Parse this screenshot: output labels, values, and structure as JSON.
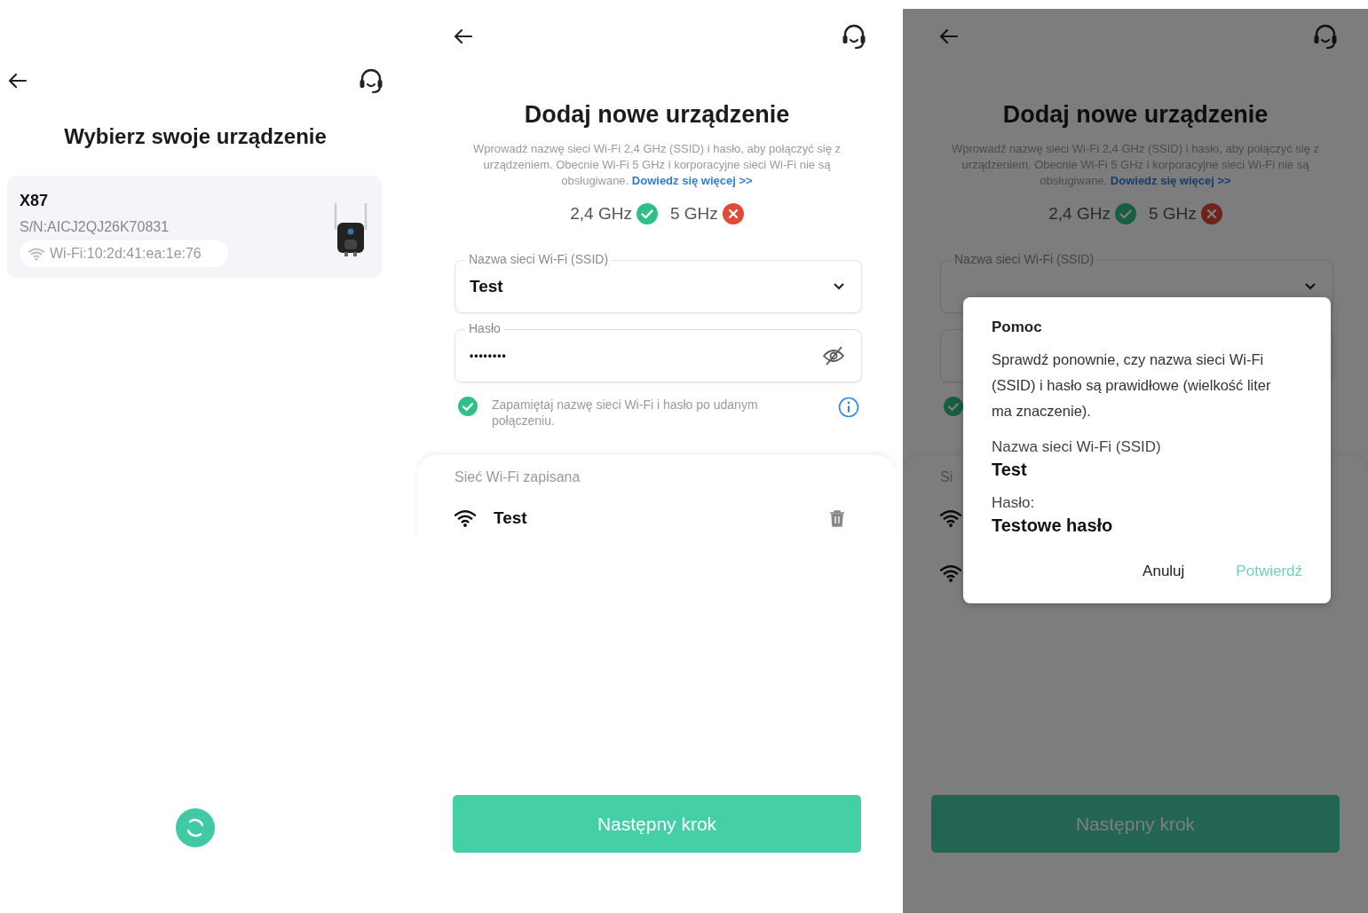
{
  "screens": [
    {
      "kind": "device_select",
      "title": "Wybierz swoje urządzenie",
      "devices": [
        {
          "name": "X87",
          "serial": "S/N:AICJ2QJ26K70831",
          "wifi": "Wi-Fi:10:2d:41:ea:1e:76"
        }
      ]
    },
    {
      "kind": "add_device",
      "dimmed": false,
      "title": "Dodaj nowe urządzenie",
      "description": "Wprowadź nazwę sieci Wi-Fi 2,4 GHz (SSID) i hasło, aby połączyć się z urządzeniem. Obecnie Wi-Fi 5 GHz i korporacyjne sieci Wi-Fi nie są obsługiwane.",
      "link": "Dowiedz się więcej >>",
      "bands": [
        {
          "label": "2,4 GHz",
          "supported": true
        },
        {
          "label": "5 GHz",
          "supported": false
        }
      ],
      "ssid_field": {
        "label": "Nazwa sieci Wi-Fi (SSID)",
        "value": "Test"
      },
      "password_field": {
        "label": "Hasło",
        "value": "••••••••"
      },
      "remember": {
        "checked": true,
        "text": "Zapamiętaj nazwę sieci Wi-Fi i hasło po udanym połączeniu."
      },
      "saved": {
        "label": "Sieć Wi-Fi zapisana",
        "networks": [
          {
            "kind": "wifi",
            "name": "Test"
          }
        ]
      },
      "next_button": "Następny krok"
    },
    {
      "kind": "add_device",
      "dimmed": true,
      "title": "Dodaj nowe urządzenie",
      "description": "Wprowadź nazwę sieci Wi-Fi 2,4 GHz (SSID) i hasło, aby połączyć się z urządzeniem. Obecnie Wi-Fi 5 GHz i korporacyjne sieci Wi-Fi nie są obsługiwane.",
      "link": "Dowiedz się więcej >>",
      "bands": [
        {
          "label": "2,4 GHz",
          "supported": true
        },
        {
          "label": "5 GHz",
          "supported": false
        }
      ],
      "ssid_field": {
        "label": "Nazwa sieci Wi-Fi (SSID)"
      },
      "remember": {
        "checked": true
      },
      "saved": {
        "label": "Si",
        "networks": [
          {
            "kind": "wifi"
          },
          {
            "kind": "wifi"
          }
        ]
      },
      "next_button": "Następny krok",
      "dialog": {
        "title": "Pomoc",
        "message": "Sprawdź ponownie, czy nazwa sieci Wi-Fi (SSID) i hasło są prawidłowe (wielkość liter ma znaczenie).",
        "fields": [
          {
            "label": "Nazwa sieci Wi-Fi (SSID)",
            "value": "Test"
          },
          {
            "label": "Hasło:",
            "value": "Testowe hasło"
          }
        ],
        "cancel": "Anuluj",
        "confirm": "Potwierdź"
      }
    }
  ]
}
